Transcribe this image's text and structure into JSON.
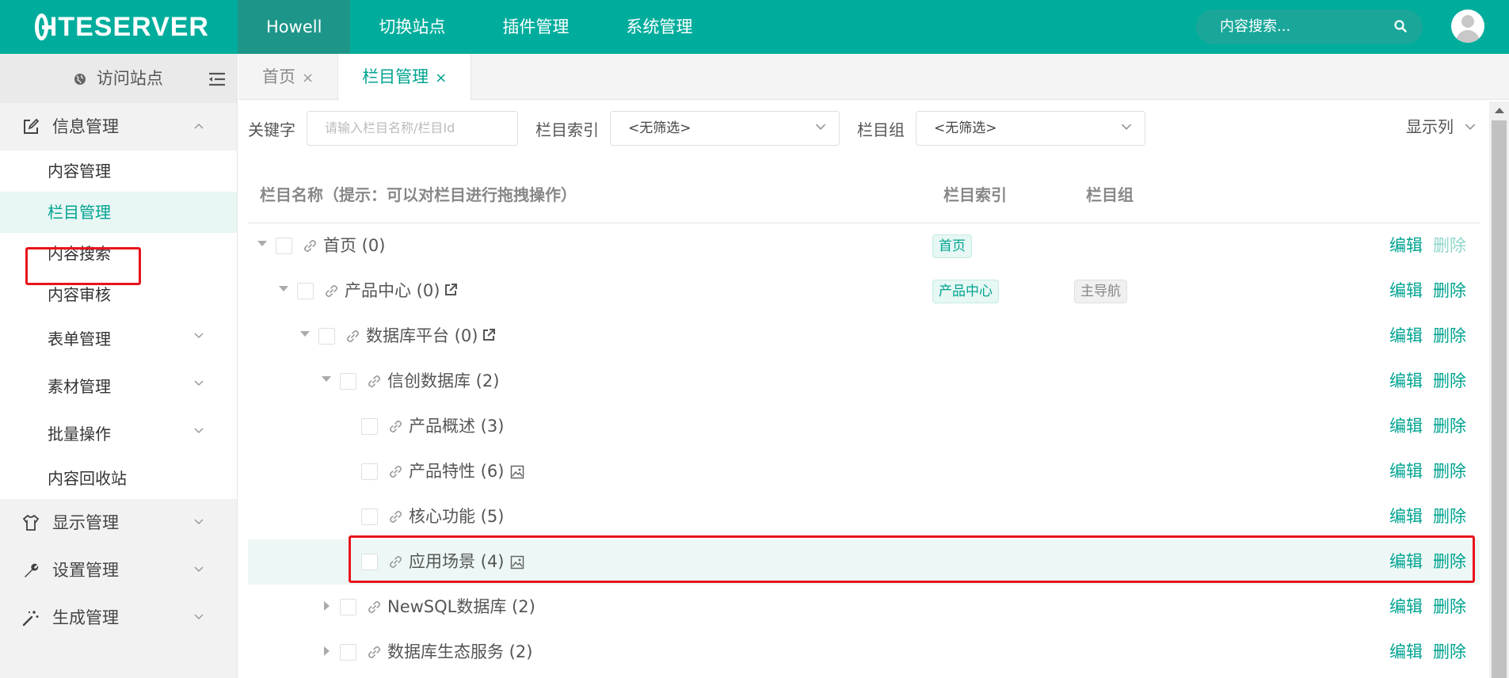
{
  "brand": {
    "logo_text": "ITESERVER"
  },
  "topnav": {
    "items": [
      "Howell",
      "切换站点",
      "插件管理",
      "系统管理"
    ]
  },
  "search": {
    "placeholder": "内容搜索..."
  },
  "sidebar": {
    "visit": "访问站点",
    "groups": [
      {
        "label": "信息管理",
        "icon": "edit-icon"
      },
      {
        "label": "显示管理",
        "icon": "shirt-icon"
      },
      {
        "label": "设置管理",
        "icon": "wrench-icon"
      },
      {
        "label": "生成管理",
        "icon": "magic-wand-icon"
      }
    ],
    "info_items": [
      "内容管理",
      "栏目管理",
      "内容搜索",
      "内容审核",
      "表单管理",
      "素材管理",
      "批量操作",
      "内容回收站"
    ]
  },
  "tabs": [
    {
      "label": "首页",
      "close": "×"
    },
    {
      "label": "栏目管理",
      "close": "×"
    }
  ],
  "filter": {
    "keyword_label": "关键字",
    "keyword_placeholder": "请输入栏目名称/栏目Id",
    "index_label": "栏目索引",
    "index_value": "<无筛选>",
    "group_label": "栏目组",
    "group_value": "<无筛选>",
    "show_columns": "显示列"
  },
  "table": {
    "headers": {
      "name": "栏目名称（提示：可以对栏目进行拖拽操作）",
      "index": "栏目索引",
      "group": "栏目组"
    },
    "edit_label": "编辑",
    "delete_label": "删除",
    "rows": [
      {
        "name": "首页 (0)",
        "index_tag": "首页",
        "group_tag": ""
      },
      {
        "name": "产品中心 (0)",
        "index_tag": "产品中心",
        "group_tag": "主导航"
      },
      {
        "name": "数据库平台 (0)",
        "index_tag": "",
        "group_tag": ""
      },
      {
        "name": "信创数据库 (2)",
        "index_tag": "",
        "group_tag": ""
      },
      {
        "name": "产品概述 (3)",
        "index_tag": "",
        "group_tag": ""
      },
      {
        "name": "产品特性 (6)",
        "index_tag": "",
        "group_tag": ""
      },
      {
        "name": "核心功能 (5)",
        "index_tag": "",
        "group_tag": ""
      },
      {
        "name": "应用场景 (4)",
        "index_tag": "",
        "group_tag": ""
      },
      {
        "name": "NewSQL数据库 (2)",
        "index_tag": "",
        "group_tag": ""
      },
      {
        "name": "数据库生态服务 (2)",
        "index_tag": "",
        "group_tag": ""
      }
    ]
  },
  "colors": {
    "primary": "#00ad9c",
    "highlight": "#e8141b"
  }
}
